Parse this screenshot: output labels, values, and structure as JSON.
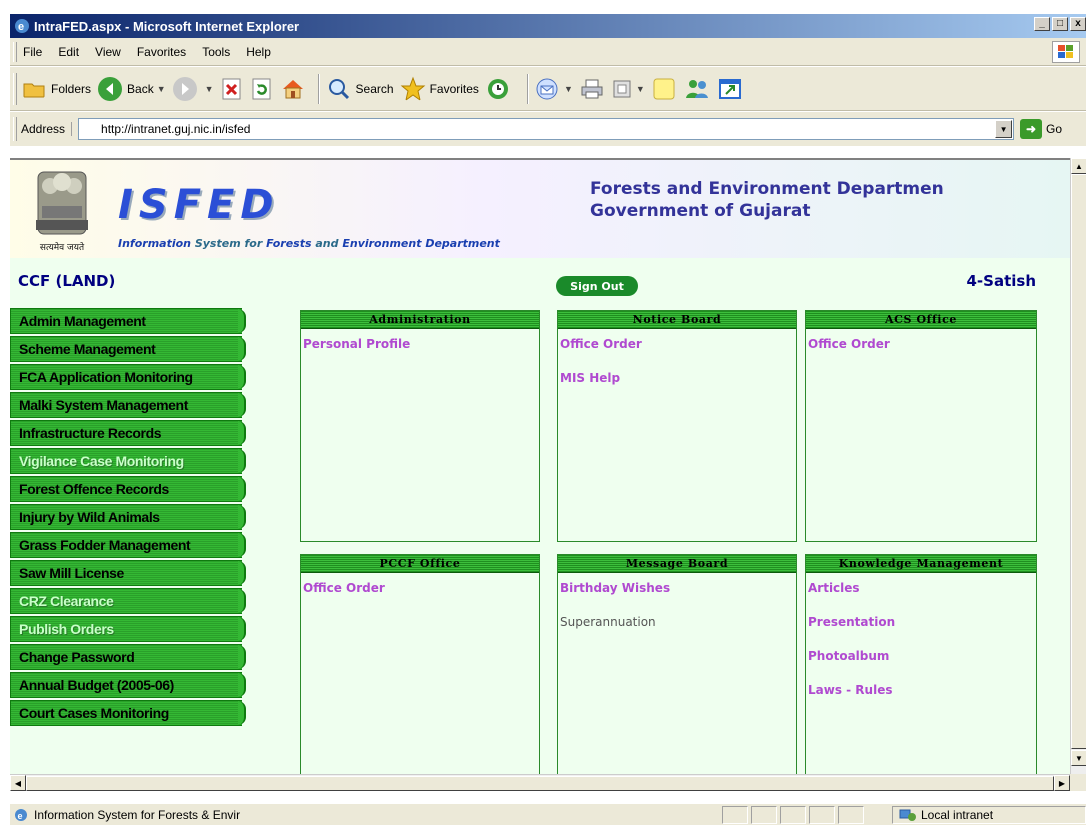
{
  "window": {
    "title": "IntraFED.aspx - Microsoft Internet Explorer",
    "minimize": "_",
    "maximize": "□",
    "close": "x"
  },
  "menu": {
    "items": [
      "File",
      "Edit",
      "View",
      "Favorites",
      "Tools",
      "Help"
    ]
  },
  "toolbar": {
    "folders": "Folders",
    "back": "Back",
    "search": "Search",
    "favorites": "Favorites"
  },
  "address": {
    "label": "Address",
    "url": "http://intranet.guj.nic.in/isfed",
    "go": "Go"
  },
  "header": {
    "logo": "ISFED",
    "emblem_caption": "सत्यमेव जयते",
    "subtitle_parts": [
      "Information",
      " System for ",
      "Forests",
      " and ",
      "Environment",
      " ",
      "Department"
    ],
    "dept_line1": "Forests and Environment Departmen",
    "dept_line2": "Government of Gujarat"
  },
  "user": {
    "role": "CCF (LAND)",
    "name": "4-Satish",
    "signout": "Sign Out"
  },
  "nav": [
    {
      "label": "Admin Management",
      "enabled": true
    },
    {
      "label": "Scheme Management",
      "enabled": true
    },
    {
      "label": "FCA Application Monitoring",
      "enabled": true
    },
    {
      "label": "Malki System Management",
      "enabled": true
    },
    {
      "label": "Infrastructure Records",
      "enabled": true
    },
    {
      "label": "Vigilance Case Monitoring",
      "enabled": false
    },
    {
      "label": "Forest Offence Records",
      "enabled": true
    },
    {
      "label": "Injury by Wild Animals",
      "enabled": true
    },
    {
      "label": "Grass Fodder Management",
      "enabled": true
    },
    {
      "label": "Saw Mill License",
      "enabled": true
    },
    {
      "label": "CRZ Clearance",
      "enabled": false
    },
    {
      "label": "Publish Orders",
      "enabled": false
    },
    {
      "label": "Change Password",
      "enabled": true
    },
    {
      "label": "Annual Budget (2005-06)",
      "enabled": true
    },
    {
      "label": "Court Cases Monitoring",
      "enabled": true
    }
  ],
  "panels": {
    "administration": {
      "title": "Administration",
      "links": [
        "Personal Profile"
      ]
    },
    "notice_board": {
      "title": "Notice Board",
      "links": [
        "Office Order",
        "MIS Help"
      ]
    },
    "acs_office": {
      "title": "ACS Office",
      "links": [
        "Office Order"
      ]
    },
    "pccf_office": {
      "title": "PCCF Office",
      "links": [
        "Office Order"
      ]
    },
    "message_board": {
      "title": "Message Board",
      "links": [
        "Birthday Wishes",
        "Superannuation"
      ]
    },
    "knowledge": {
      "title": "Knowledge Management",
      "links": [
        "Articles",
        "Presentation",
        "Photoalbum",
        "Laws - Rules"
      ]
    }
  },
  "status": {
    "text": "Information System for Forests & Envir",
    "zone": "Local intranet"
  }
}
